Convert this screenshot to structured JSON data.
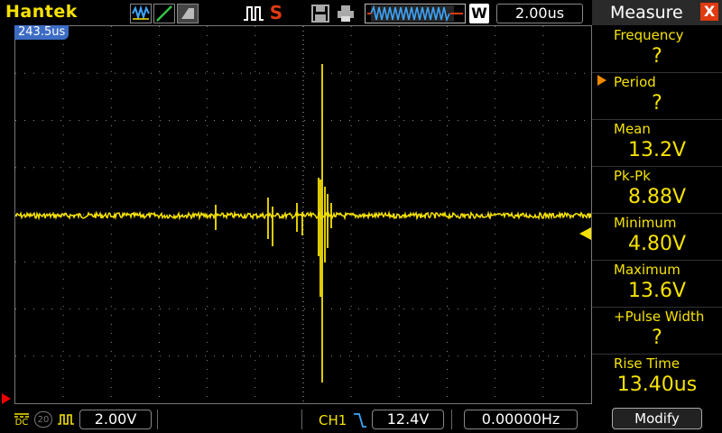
{
  "brand": "Hantek",
  "header": {
    "trigger_mode_letter": "S",
    "timebase": "2.00us",
    "window_letter": "W",
    "trigger_position": "243.5us"
  },
  "icons": [
    "waveform-math-icon",
    "edge-slope-icon",
    "persistence-icon",
    "pulse-trigger-icon",
    "save-disk-icon",
    "printer-icon",
    "memory-trace-icon",
    "channel-marker-icon",
    "trigger-level-icon",
    "coupling-dc-icon",
    "bandwidth-20-icon",
    "probe-icon",
    "trigger-edge-icon",
    "close-icon"
  ],
  "colors": {
    "channel1": "#f6e200",
    "accent": "#e03a10",
    "selector": "#f08a00",
    "trigpos": "#3d6cc4"
  },
  "measure": {
    "title": "Measure",
    "close_label": "X",
    "items": [
      {
        "label": "Frequency",
        "value": "?"
      },
      {
        "label": "Period",
        "value": "?"
      },
      {
        "label": "Mean",
        "value": "13.2V"
      },
      {
        "label": "Pk-Pk",
        "value": "8.88V"
      },
      {
        "label": "Minimum",
        "value": "4.80V"
      },
      {
        "label": "Maximum",
        "value": "13.6V"
      },
      {
        "label": "+Pulse Width",
        "value": "?"
      },
      {
        "label": "Rise Time",
        "value": "13.40us"
      }
    ],
    "selected_index": 1,
    "modify_label": "Modify"
  },
  "bottom": {
    "coupling": "DC",
    "bandwidth": "20",
    "volts_div": "2.00V",
    "trigger_source": "CH1",
    "trigger_level": "12.4V",
    "frequency": "0.00000Hz"
  }
}
